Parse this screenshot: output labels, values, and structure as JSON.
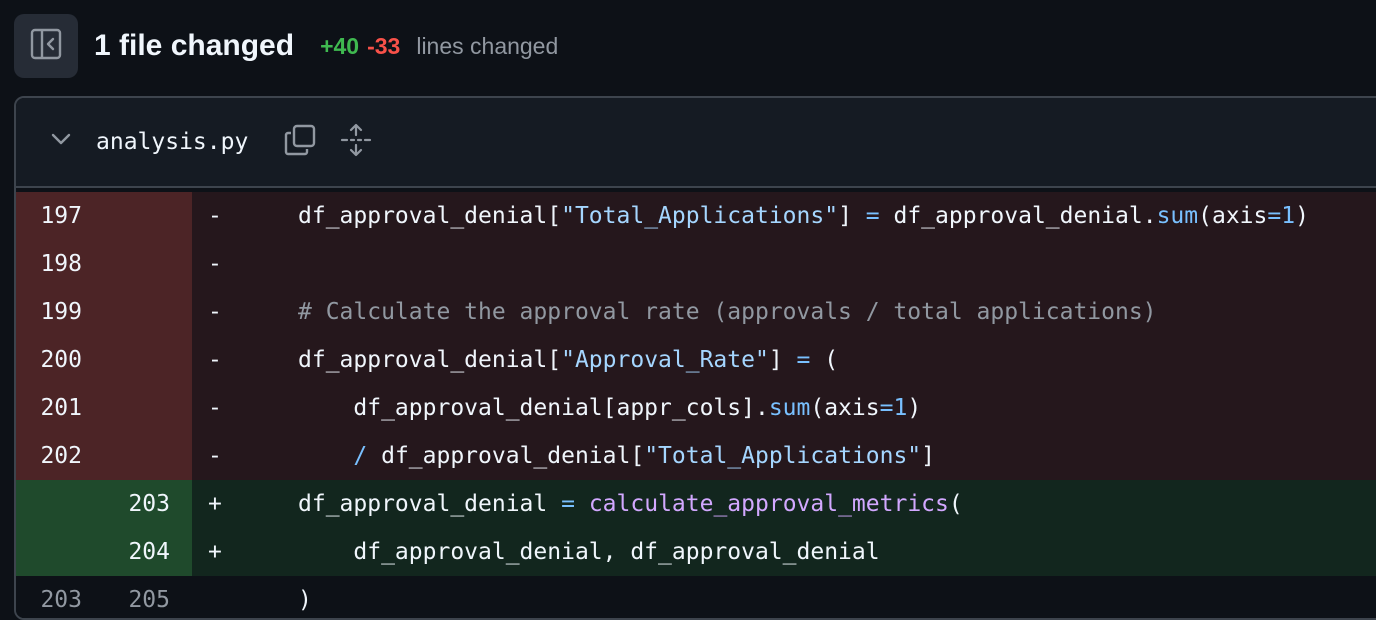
{
  "header": {
    "title": "1 file changed",
    "additions": "+40",
    "deletions": "-33",
    "lines_label": "lines changed"
  },
  "file": {
    "name": "analysis.py"
  },
  "diff_lines": [
    {
      "type": "del",
      "old": "197",
      "new": "",
      "sign": "-",
      "indent": "",
      "tokens": [
        {
          "t": "df_approval_denial[",
          "c": ""
        },
        {
          "t": "\"Total_Applications\"",
          "c": "s"
        },
        {
          "t": "] ",
          "c": ""
        },
        {
          "t": "=",
          "c": "k"
        },
        {
          "t": " df_approval_denial.",
          "c": ""
        },
        {
          "t": "sum",
          "c": "k"
        },
        {
          "t": "(axis",
          "c": ""
        },
        {
          "t": "=",
          "c": "k"
        },
        {
          "t": "1",
          "c": "k"
        },
        {
          "t": ")",
          "c": ""
        }
      ]
    },
    {
      "type": "del",
      "old": "198",
      "new": "",
      "sign": "-",
      "indent": "",
      "tokens": []
    },
    {
      "type": "del",
      "old": "199",
      "new": "",
      "sign": "-",
      "indent": "",
      "tokens": [
        {
          "t": "# Calculate the approval rate (approvals / total applications)",
          "c": "c"
        }
      ]
    },
    {
      "type": "del",
      "old": "200",
      "new": "",
      "sign": "-",
      "indent": "",
      "tokens": [
        {
          "t": "df_approval_denial[",
          "c": ""
        },
        {
          "t": "\"Approval_Rate\"",
          "c": "s"
        },
        {
          "t": "] ",
          "c": ""
        },
        {
          "t": "=",
          "c": "k"
        },
        {
          "t": " (",
          "c": ""
        }
      ]
    },
    {
      "type": "del",
      "old": "201",
      "new": "",
      "sign": "-",
      "indent": "    ",
      "tokens": [
        {
          "t": "df_approval_denial[appr_cols].",
          "c": ""
        },
        {
          "t": "sum",
          "c": "k"
        },
        {
          "t": "(axis",
          "c": ""
        },
        {
          "t": "=",
          "c": "k"
        },
        {
          "t": "1",
          "c": "k"
        },
        {
          "t": ")",
          "c": ""
        }
      ]
    },
    {
      "type": "del",
      "old": "202",
      "new": "",
      "sign": "-",
      "indent": "    ",
      "tokens": [
        {
          "t": "/",
          "c": "k"
        },
        {
          "t": " df_approval_denial[",
          "c": ""
        },
        {
          "t": "\"Total_Applications\"",
          "c": "s"
        },
        {
          "t": "]",
          "c": ""
        }
      ]
    },
    {
      "type": "add",
      "old": "",
      "new": "203",
      "sign": "+",
      "indent": "",
      "tokens": [
        {
          "t": "df_approval_denial ",
          "c": ""
        },
        {
          "t": "=",
          "c": "k"
        },
        {
          "t": " ",
          "c": ""
        },
        {
          "t": "calculate_approval_metrics",
          "c": "f"
        },
        {
          "t": "(",
          "c": ""
        }
      ]
    },
    {
      "type": "add",
      "old": "",
      "new": "204",
      "sign": "+",
      "indent": "    ",
      "tokens": [
        {
          "t": "df_approval_denial, df_approval_denial",
          "c": ""
        }
      ]
    },
    {
      "type": "ctx",
      "old": "203",
      "new": "205",
      "sign": "",
      "indent": "",
      "tokens": [
        {
          "t": ")",
          "c": ""
        }
      ]
    }
  ]
}
